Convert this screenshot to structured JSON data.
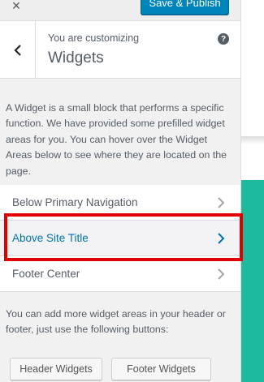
{
  "header": {
    "close_symbol": "×",
    "publish_label": "Save & Publish"
  },
  "section": {
    "customizing_label": "You are customizing",
    "title": "Widgets",
    "help_symbol": "?"
  },
  "description": "A Widget is a small block that performs a specific function. We have provided some prefilled widget areas for you. You can hover over the Widget Areas below to see where they are located on the page.",
  "widget_areas": [
    {
      "label": "Below Primary Navigation",
      "active": false
    },
    {
      "label": "Above Site Title",
      "active": true
    },
    {
      "label": "Footer Center",
      "active": false
    }
  ],
  "more_text": "You can add more widget areas in your header or footer, just use the following buttons:",
  "buttons": {
    "header_widgets": "Header Widgets",
    "footer_widgets": "Footer Widgets"
  },
  "colors": {
    "accent_blue": "#0073aa",
    "publish_blue": "#0085ba",
    "highlight_red": "#e00000",
    "preview_teal": "#1fb99d"
  },
  "icons": {
    "close": "close-icon",
    "back": "chevron-left-icon",
    "help": "help-icon",
    "item": "chevron-right-icon"
  }
}
